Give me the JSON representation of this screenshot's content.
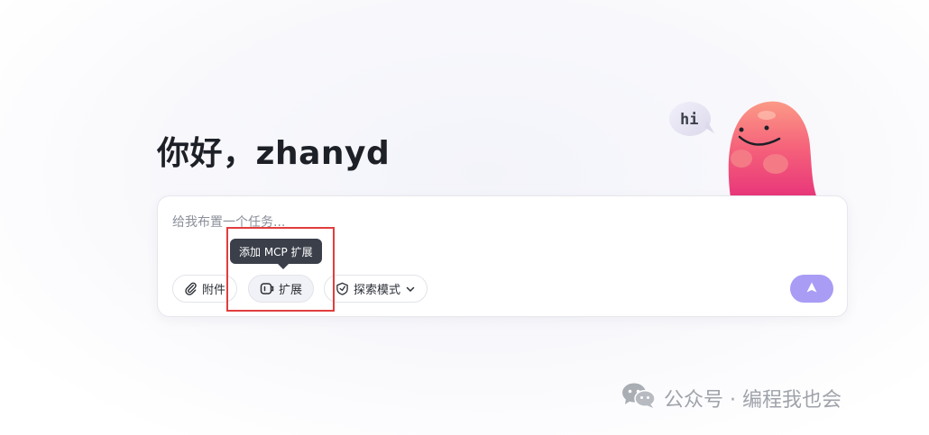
{
  "greeting": {
    "text": "你好，zhanyd"
  },
  "mascot": {
    "speech_bubble": "hi",
    "icon": "mascot-character",
    "body_color": "#f55f78"
  },
  "composer": {
    "placeholder": "给我布置一个任务...",
    "value": "",
    "tools": {
      "attach": {
        "label": "附件",
        "icon": "paperclip-icon"
      },
      "extensions": {
        "label": "扩展",
        "icon": "extension-icon"
      },
      "mode": {
        "label": "探索模式",
        "icon": "explore-icon",
        "dropdown_icon": "chevron-down-icon"
      }
    },
    "send": {
      "icon": "send-arrow-icon",
      "color": "#a89cf5"
    }
  },
  "tooltip": {
    "text": "添加 MCP 扩展"
  },
  "annotation": {
    "color": "#e23d3d"
  },
  "watermark": {
    "text": "公众号 · 编程我也会",
    "icon": "wechat-icon"
  }
}
